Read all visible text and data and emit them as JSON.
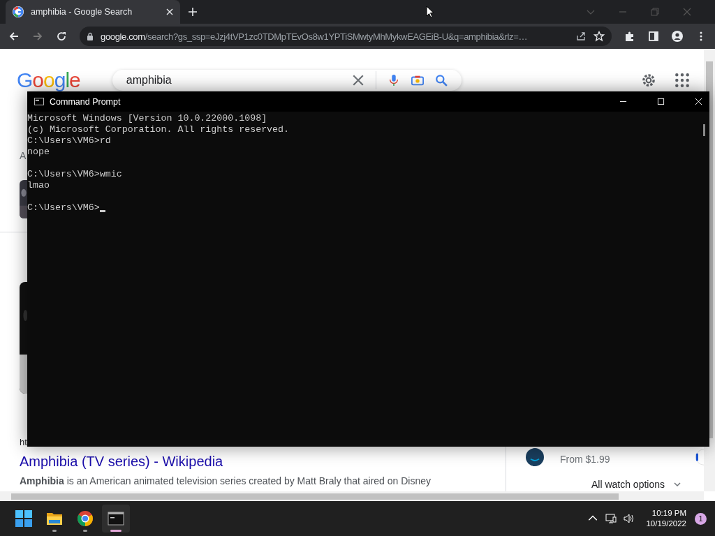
{
  "browser": {
    "tabs": [
      {
        "title": "amphibia - Google Search",
        "selected": true
      }
    ],
    "address": {
      "domain": "google.com",
      "path": "/search?gs_ssp=eJzj4tVP1zc0TDMpTEvOs8w1YPTiSMwtyMhMykwEAGEiB-U&q=amphibia&rlz=…"
    }
  },
  "page": {
    "logo": "Google",
    "search": {
      "value": "amphibia"
    },
    "fragments": [
      "A"
    ],
    "result": {
      "url_fragment": "ht",
      "title": "Amphibia (TV series) - Wikipedia",
      "snippet": "**Amphibia** is an American animated television series created by Matt Braly that aired on Disney"
    },
    "watch": {
      "price": "From $1.99",
      "options": "All watch options"
    }
  },
  "console": {
    "title": "Command Prompt",
    "header": [
      "Microsoft Windows [Version 10.0.22000.1098]",
      "(c) Microsoft Corporation. All rights reserved."
    ],
    "commands": [
      {
        "prompt": "C:\\Users\\VM6>",
        "command": "rd",
        "output": "nope"
      },
      {
        "prompt": "C:\\Users\\VM6>",
        "command": "wmic",
        "output": "lmao"
      }
    ],
    "current_prompt": "C:\\Users\\VM6>"
  },
  "taskbar": {
    "apps": [
      {
        "kind": "start",
        "running": false,
        "selected": false
      },
      {
        "kind": "explorer",
        "running": true,
        "selected": false
      },
      {
        "kind": "chrome",
        "running": true,
        "selected": false
      },
      {
        "kind": "terminal",
        "running": true,
        "selected": true
      }
    ],
    "time": "10:19 PM",
    "date": "10/19/2022",
    "notifications": "1"
  }
}
